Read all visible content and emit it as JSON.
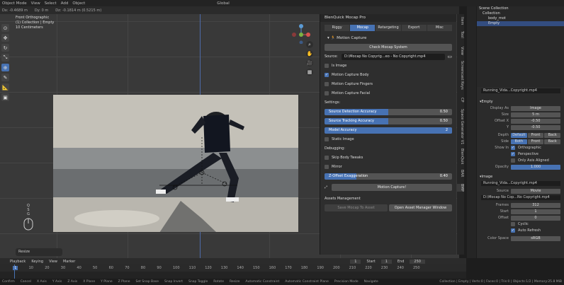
{
  "topbar": {
    "mode": "Object Mode",
    "view": "View",
    "select": "Select",
    "add": "Add",
    "object": "Object",
    "transform": "Global"
  },
  "tool_header": {
    "dx": "Dx: -0.4689 m",
    "dy": "Dy: 0 m",
    "dz": "Dz: -0.1814 m (0.5215 m)"
  },
  "viewport": {
    "view_name": "Front Orthographic",
    "collection": "(1) Collection | Empty",
    "scale": "10 Centimeters",
    "mouse_keys": [
      "Q",
      "S",
      "G"
    ],
    "resize_label": "Resize"
  },
  "panel": {
    "title": "BlenQuick Mocap Pro",
    "tabs": [
      "Riggy",
      "Mocap",
      "Retargeting",
      "Export",
      "Misc"
    ],
    "active_tab": "Mocap",
    "section": "Motion Capture",
    "check_button": "Check Mocap System",
    "source_label": "Source:",
    "source_value": "D:\\Mocap No Copyrig...eo - No Copyright.mp4",
    "checks": [
      {
        "label": "Is Image",
        "on": false
      },
      {
        "label": "Motion Capture Body",
        "on": true
      },
      {
        "label": "Motion Capture Fingers",
        "on": false
      },
      {
        "label": "Motion Capture Facial",
        "on": false
      }
    ],
    "settings_label": "Settings:",
    "sliders": [
      {
        "label": "Source Detection Accuracy",
        "value": "0.50",
        "fraction": 0.5
      },
      {
        "label": "Source Tracking Accuracy",
        "value": "0.50",
        "fraction": 0.5
      },
      {
        "label": "Model Accuracy",
        "value": "2",
        "fraction": 1.0
      }
    ],
    "static_image": "Static Image",
    "debugging_label": "Debugging:",
    "debug_checks": [
      {
        "label": "Skip Body Tweaks",
        "on": false
      },
      {
        "label": "Mirror",
        "on": false
      }
    ],
    "zoffset": {
      "label": "Z-Offset Exaggeration",
      "value": "0.40",
      "fraction": 0.25
    },
    "capture_button": "Motion Capture!",
    "assets_label": "Assets Management",
    "save_asset": "Save Mocap To Asset",
    "open_asset": "Open Asset Manager Window"
  },
  "vtabs": [
    "Item",
    "Tool",
    "View",
    "Screencast Keys",
    "CP",
    "Space Generator V1",
    "BlenQuik",
    "BAR",
    "BMP"
  ],
  "outliner": {
    "scene": "Scene Collection",
    "collection": "Collection",
    "items": [
      "body_mot",
      "Empty"
    ]
  },
  "props": {
    "image_name": "Running_Vida...Copyright.mp4",
    "empty_label": "Empty",
    "display_as": "Image",
    "size": "5 m",
    "offset_x": "-0.50",
    "offset_y": "-0.50",
    "depth": [
      "Default",
      "Front",
      "Back"
    ],
    "side": [
      "Both",
      "Front",
      "Back"
    ],
    "show_in": [
      "Orthographic",
      "Perspective",
      "Only Axis Aligned"
    ],
    "opacity": "1.000",
    "image_label": "Image",
    "source": "Movie",
    "file": "D:\\Mocap No Cop...No Copyright.mp4",
    "frames": "312",
    "start": "1",
    "offset": "0",
    "cyclic": "Cyclic",
    "auto_refresh": "Auto Refresh",
    "color_space": "sRGB"
  },
  "timeline": {
    "playback": "Playback",
    "keying": "Keying",
    "view": "View",
    "marker": "Marker",
    "current": "1",
    "start_label": "Start",
    "start": "1",
    "end_label": "End",
    "end": "250",
    "ticks": [
      "1",
      "10",
      "20",
      "30",
      "40",
      "50",
      "60",
      "70",
      "80",
      "90",
      "100",
      "110",
      "120",
      "130",
      "140",
      "150",
      "160",
      "170",
      "180",
      "190",
      "200",
      "210",
      "220",
      "230",
      "240",
      "250"
    ]
  },
  "statusbar": {
    "items": [
      "Confirm",
      "Cancel",
      "X Axis",
      "Y Axis",
      "Z Axis",
      "X Plane",
      "Y Plane",
      "Z Plane",
      "Set Snap Base",
      "Snap Invert",
      "Snap Toggle",
      "Rotate",
      "Resize",
      "Automatic Constraint",
      "Automatic Constraint Plane",
      "Precision Mode",
      "Navigate"
    ],
    "right": "Collection | Empty | Verts:0 | Faces:0 | Tris:0 | Objects:1/2 | Memory:25.8 MiB"
  }
}
